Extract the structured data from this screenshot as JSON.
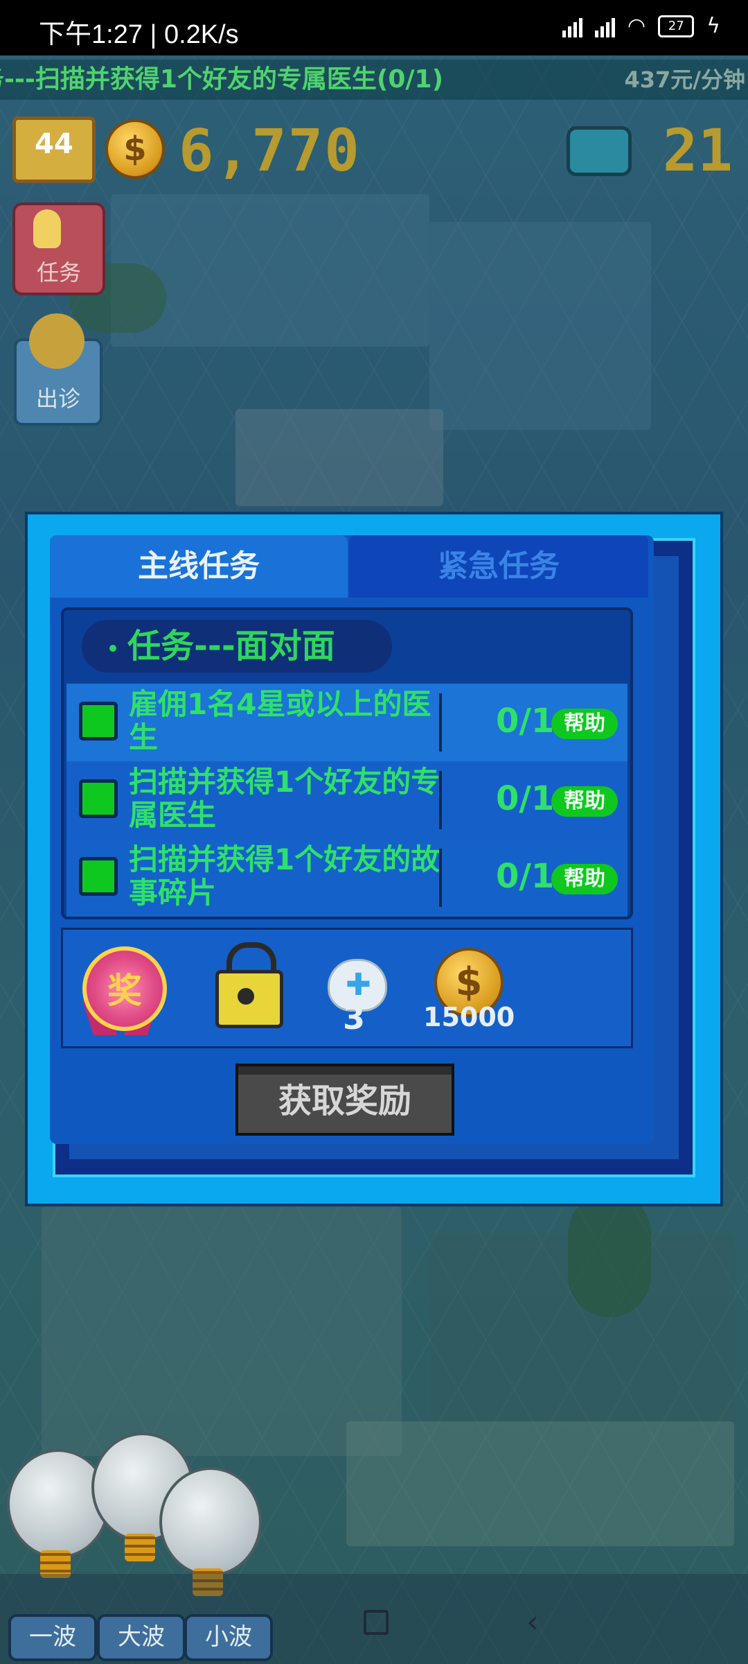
{
  "status_bar": {
    "time": "下午1:27 | 0.2K/s",
    "battery": "27",
    "icons": [
      "bell-off-icon",
      "alarm-icon",
      "nfc-icon",
      "signal-hd-icon",
      "signal-hd-icon",
      "wifi-icon",
      "battery-icon",
      "charging-icon"
    ]
  },
  "hud": {
    "ticker_text": "务---扫描并获得1个好友的专属医生(0/1)",
    "income_rate": "437元/分钟",
    "level": "44",
    "money": "6,770",
    "gems": "21",
    "task_button_label": "任务",
    "outpatient_button_label": "出诊"
  },
  "dialog": {
    "tabs": [
      {
        "label": "主线任务",
        "active": true
      },
      {
        "label": "紧急任务",
        "active": false
      }
    ],
    "task_group_title": "任务---面对面",
    "tasks": [
      {
        "text": "雇佣1名4星或以上的医生",
        "progress": "0/1",
        "help_label": "帮助"
      },
      {
        "text": "扫描并获得1个好友的专属医生",
        "progress": "0/1",
        "help_label": "帮助"
      },
      {
        "text": "扫描并获得1个好友的故事碎片",
        "progress": "0/1",
        "help_label": "帮助"
      }
    ],
    "rewards": {
      "medal_text": "奖",
      "cat_count": "3",
      "coin_amount": "15000"
    },
    "claim_button_label": "获取奖励"
  },
  "bottom": {
    "wave_buttons": [
      "一波",
      "大波",
      "小波"
    ]
  },
  "colors": {
    "dialog_border": "#0aa8ef",
    "task_text": "#2fe06a",
    "help_button": "#0fc81f"
  }
}
